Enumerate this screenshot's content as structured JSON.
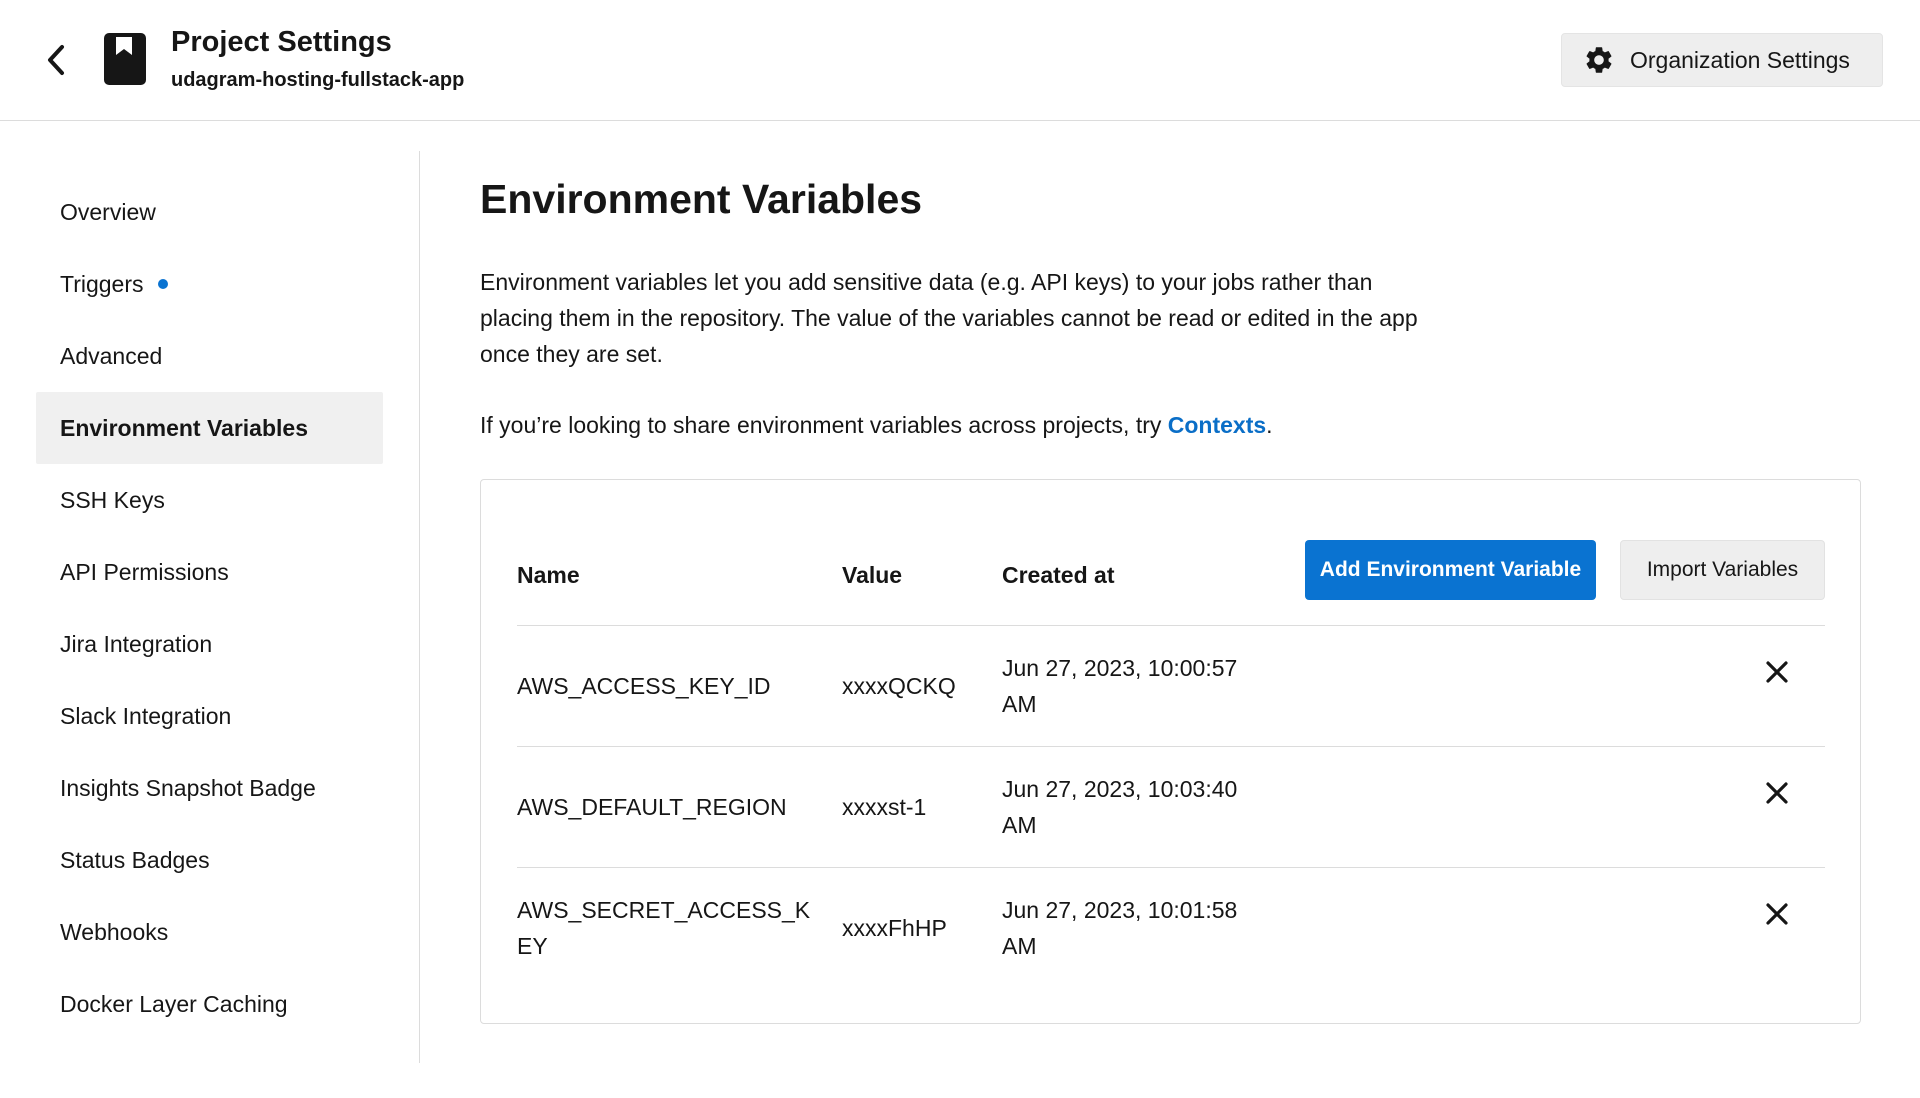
{
  "header": {
    "title": "Project Settings",
    "subtitle": "udagram-hosting-fullstack-app",
    "org_button": "Organization Settings"
  },
  "sidebar": {
    "items": [
      {
        "label": "Overview"
      },
      {
        "label": "Triggers",
        "dot": true
      },
      {
        "label": "Advanced"
      },
      {
        "label": "Environment Variables",
        "active": true
      },
      {
        "label": "SSH Keys"
      },
      {
        "label": "API Permissions"
      },
      {
        "label": "Jira Integration"
      },
      {
        "label": "Slack Integration"
      },
      {
        "label": "Insights Snapshot Badge"
      },
      {
        "label": "Status Badges"
      },
      {
        "label": "Webhooks"
      },
      {
        "label": "Docker Layer Caching"
      }
    ]
  },
  "main": {
    "title": "Environment Variables",
    "description": "Environment variables let you add sensitive data (e.g. API keys) to your jobs rather than placing them in the repository. The value of the variables cannot be read or edited in the app once they are set.",
    "contexts_prefix": "If you’re looking to share environment variables across projects, try ",
    "contexts_link": "Contexts",
    "contexts_suffix": "."
  },
  "table": {
    "headers": {
      "name": "Name",
      "value": "Value",
      "created": "Created at"
    },
    "add_button": "Add Environment Variable",
    "import_button": "Import Variables",
    "rows": [
      {
        "name": "AWS_ACCESS_KEY_ID",
        "value": "xxxxQCKQ",
        "created": "Jun 27, 2023, 10:00:57 AM"
      },
      {
        "name": "AWS_DEFAULT_REGION",
        "value": "xxxxst-1",
        "created": "Jun 27, 2023, 10:03:40 AM"
      },
      {
        "name": "AWS_SECRET_ACCESS_KEY",
        "value": "xxxxFhHP",
        "created": "Jun 27, 2023, 10:01:58 AM"
      }
    ]
  },
  "colors": {
    "accent": "#0a73d1",
    "link": "#0a6ec7",
    "text": "#161616"
  }
}
